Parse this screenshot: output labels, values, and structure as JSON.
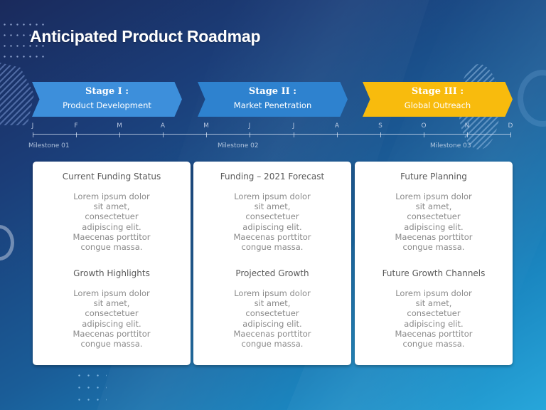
{
  "title": "Anticipated Product Roadmap",
  "stages": [
    {
      "title": "Stage I :",
      "subtitle": "Product Development",
      "color": "#3d8fdb"
    },
    {
      "title": "Stage II :",
      "subtitle": "Market Penetration",
      "color": "#2e82cf"
    },
    {
      "title": "Stage III :",
      "subtitle": "Global Outreach",
      "color": "#f8bb0d"
    }
  ],
  "timeline": {
    "months": [
      "J",
      "F",
      "M",
      "A",
      "M",
      "J",
      "J",
      "A",
      "S",
      "O",
      "N",
      "D"
    ],
    "milestones": [
      "Milestone 01",
      "Milestone 02",
      "Milestone 03"
    ]
  },
  "cards": [
    {
      "sections": [
        {
          "heading": "Current Funding Status",
          "body": "Lorem ipsum dolor\nsit amet,\nconsectetuer\nadipiscing elit.\nMaecenas porttitor\ncongue massa."
        },
        {
          "heading": "Growth Highlights",
          "body": "Lorem ipsum dolor\nsit amet,\nconsectetuer\nadipiscing elit.\nMaecenas porttitor\ncongue massa."
        }
      ]
    },
    {
      "sections": [
        {
          "heading": "Funding – 2021 Forecast",
          "body": "Lorem ipsum dolor\nsit amet,\nconsectetuer\nadipiscing elit.\nMaecenas porttitor\ncongue massa."
        },
        {
          "heading": "Projected Growth",
          "body": "Lorem ipsum dolor\nsit amet,\nconsectetuer\nadipiscing elit.\nMaecenas porttitor\ncongue massa."
        }
      ]
    },
    {
      "sections": [
        {
          "heading": "Future Planning",
          "body": "Lorem ipsum dolor\nsit amet,\nconsectetuer\nadipiscing elit.\nMaecenas porttitor\ncongue massa."
        },
        {
          "heading": "Future Growth Channels",
          "body": "Lorem ipsum dolor\nsit amet,\nconsectetuer\nadipiscing elit.\nMaecenas porttitor\ncongue massa."
        }
      ]
    }
  ]
}
